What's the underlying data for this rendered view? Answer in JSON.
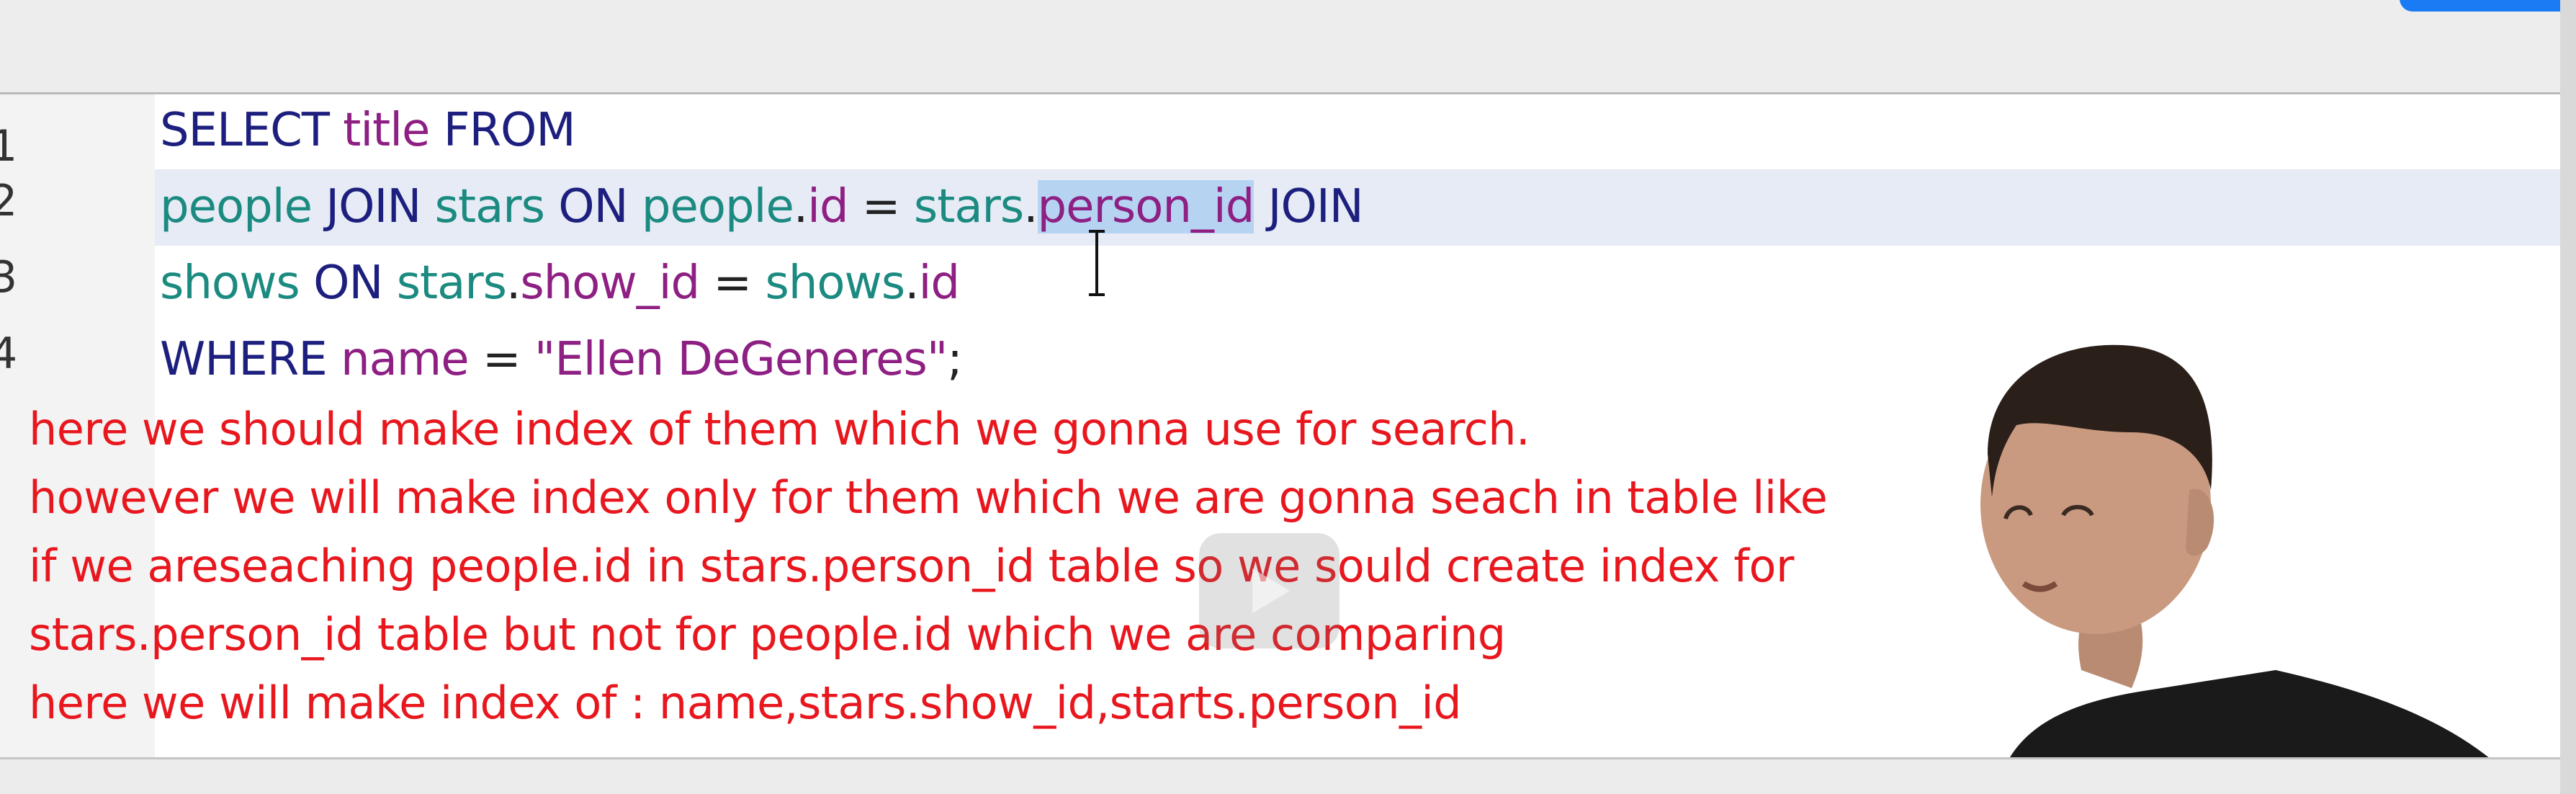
{
  "editor": {
    "line_numbers": [
      "1",
      "2",
      "3",
      "4"
    ],
    "lines": [
      {
        "tokens": [
          {
            "text": "SELECT",
            "kind": "kw"
          },
          {
            "text": " ",
            "kind": "op"
          },
          {
            "text": "title",
            "kind": "col"
          },
          {
            "text": " ",
            "kind": "op"
          },
          {
            "text": "FROM",
            "kind": "kw"
          }
        ]
      },
      {
        "tokens": [
          {
            "text": "people",
            "kind": "tb"
          },
          {
            "text": " ",
            "kind": "op"
          },
          {
            "text": "JOIN",
            "kind": "kw"
          },
          {
            "text": " ",
            "kind": "op"
          },
          {
            "text": "stars",
            "kind": "tb"
          },
          {
            "text": " ",
            "kind": "op"
          },
          {
            "text": "ON",
            "kind": "kw"
          },
          {
            "text": " ",
            "kind": "op"
          },
          {
            "text": "people",
            "kind": "tb"
          },
          {
            "text": ".",
            "kind": "op"
          },
          {
            "text": "id",
            "kind": "col"
          },
          {
            "text": " = ",
            "kind": "op"
          },
          {
            "text": "stars",
            "kind": "tb"
          },
          {
            "text": ".",
            "kind": "op"
          },
          {
            "text": "person_id",
            "kind": "col",
            "selected": true
          },
          {
            "text": " ",
            "kind": "op"
          },
          {
            "text": "JOIN",
            "kind": "kw"
          }
        ]
      },
      {
        "tokens": [
          {
            "text": "shows",
            "kind": "tb"
          },
          {
            "text": " ",
            "kind": "op"
          },
          {
            "text": "ON",
            "kind": "kw"
          },
          {
            "text": " ",
            "kind": "op"
          },
          {
            "text": "stars",
            "kind": "tb"
          },
          {
            "text": ".",
            "kind": "op"
          },
          {
            "text": "show_id",
            "kind": "col"
          },
          {
            "text": " = ",
            "kind": "op"
          },
          {
            "text": "shows",
            "kind": "tb"
          },
          {
            "text": ".",
            "kind": "op"
          },
          {
            "text": "id",
            "kind": "col"
          }
        ]
      },
      {
        "tokens": [
          {
            "text": "WHERE",
            "kind": "kw"
          },
          {
            "text": " ",
            "kind": "op"
          },
          {
            "text": "name",
            "kind": "col"
          },
          {
            "text": " = ",
            "kind": "op"
          },
          {
            "text": "\"Ellen DeGeneres\"",
            "kind": "str"
          },
          {
            "text": ";",
            "kind": "op"
          }
        ]
      }
    ]
  },
  "notes": [
    "here we should make index of them which we gonna use for search.",
    "however we will make index only for them which we are gonna seach in table like",
    "if we areseaching people.id in stars.person_id table so we sould create index for",
    "stars.person_id table but not for people.id which we are comparing",
    "here we will make index of : name,stars.show_id,starts.person_id"
  ],
  "colors": {
    "keyword": "#1d1f7e",
    "table": "#1b8a80",
    "column": "#8e1f83",
    "note_text": "#e8171e",
    "selection": "#b6d3f2",
    "current_line": "#e6ebf5",
    "accent_button": "#1a7cf5"
  },
  "icons": {
    "cursor": "i-beam-cursor-icon",
    "play": "play-icon"
  }
}
